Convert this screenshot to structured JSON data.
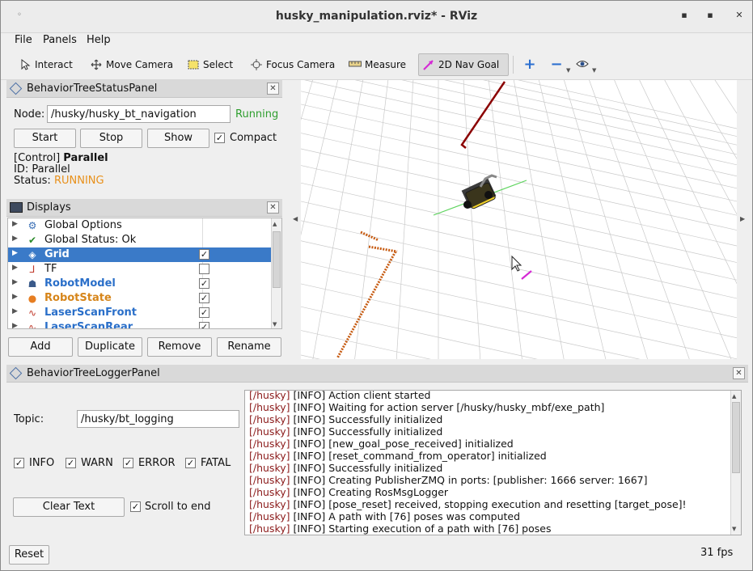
{
  "window": {
    "title": "husky_manipulation.rviz* - RViz",
    "min_glyph": "▪",
    "max_glyph": "▪",
    "close_glyph": "✕"
  },
  "menu": {
    "file": "File",
    "panels": "Panels",
    "help": "Help"
  },
  "toolbar": {
    "interact": "Interact",
    "move_camera": "Move Camera",
    "select": "Select",
    "focus_camera": "Focus Camera",
    "measure": "Measure",
    "nav_goal": "2D Nav Goal",
    "active_tool": "2D Nav Goal",
    "add_glyph": "+",
    "remove_glyph": "−"
  },
  "bt_status_panel": {
    "title": "BehaviorTreeStatusPanel",
    "node_label": "Node:",
    "node_value": "/husky/husky_bt_navigation",
    "state": "Running",
    "start": "Start",
    "stop": "Stop",
    "show": "Show",
    "compact_label": "Compact",
    "compact_checked": true,
    "control_prefix": "[Control]",
    "control_name": "Parallel",
    "id_line": "ID: Parallel",
    "status_label": "Status:",
    "status_value": "RUNNING"
  },
  "displays": {
    "title": "Displays",
    "items": [
      {
        "name": "Global Options",
        "checkable": false,
        "checked": false,
        "selected": false,
        "style": "plain"
      },
      {
        "name": "Global Status: Ok",
        "checkable": false,
        "checked": false,
        "selected": false,
        "style": "plain"
      },
      {
        "name": "Grid",
        "checkable": true,
        "checked": true,
        "selected": true,
        "style": "bold"
      },
      {
        "name": "TF",
        "checkable": true,
        "checked": false,
        "selected": false,
        "style": "plain"
      },
      {
        "name": "RobotModel",
        "checkable": true,
        "checked": true,
        "selected": false,
        "style": "blue"
      },
      {
        "name": "RobotState",
        "checkable": true,
        "checked": true,
        "selected": false,
        "style": "orange"
      },
      {
        "name": "LaserScanFront",
        "checkable": true,
        "checked": true,
        "selected": false,
        "style": "blue"
      },
      {
        "name": "LaserScanRear",
        "checkable": true,
        "checked": true,
        "selected": false,
        "style": "blue"
      }
    ],
    "buttons": {
      "add": "Add",
      "duplicate": "Duplicate",
      "remove": "Remove",
      "rename": "Rename"
    }
  },
  "logger_panel": {
    "title": "BehaviorTreeLoggerPanel",
    "topic_label": "Topic:",
    "topic_value": "/husky/bt_logging",
    "filters": [
      {
        "label": "INFO",
        "checked": true
      },
      {
        "label": "WARN",
        "checked": true
      },
      {
        "label": "ERROR",
        "checked": true
      },
      {
        "label": "FATAL",
        "checked": true
      }
    ],
    "clear_text": "Clear Text",
    "scroll_to_end_label": "Scroll to end",
    "scroll_to_end_checked": true,
    "log_lines": [
      {
        "tag": "[/husky]",
        "text": " [INFO] Action client started"
      },
      {
        "tag": "[/husky]",
        "text": " [INFO] Waiting for action server [/husky/husky_mbf/exe_path]"
      },
      {
        "tag": "[/husky]",
        "text": " [INFO] Successfully initialized"
      },
      {
        "tag": "[/husky]",
        "text": " [INFO] Successfully initialized"
      },
      {
        "tag": "[/husky]",
        "text": " [INFO] [new_goal_pose_received] initialized"
      },
      {
        "tag": "[/husky]",
        "text": " [INFO] [reset_command_from_operator] initialized"
      },
      {
        "tag": "[/husky]",
        "text": " [INFO] Successfully initialized"
      },
      {
        "tag": "[/husky]",
        "text": " [INFO] Creating PublisherZMQ in ports: [publisher: 1666 server: 1667]"
      },
      {
        "tag": "[/husky]",
        "text": " [INFO] Creating RosMsgLogger"
      },
      {
        "tag": "[/husky]",
        "text": " [INFO] [pose_reset] received, stopping execution and resetting [target_pose]!"
      },
      {
        "tag": "[/husky]",
        "text": " [INFO] A path with [76] poses was computed"
      },
      {
        "tag": "[/husky]",
        "text": " [INFO] Starting execution of a path with [76] poses"
      }
    ]
  },
  "statusbar": {
    "reset": "Reset",
    "fps": "31 fps"
  },
  "colors": {
    "running": "#2e9e2e",
    "status_running": "#e8901a",
    "selected_row": "#3a7ac8",
    "display_blue": "#2a6fc9",
    "display_orange": "#d6851a",
    "log_tag": "#8b1a1a"
  },
  "icons": {
    "interact": "cursor-icon",
    "move_camera": "move-icon",
    "select": "select-box-icon",
    "focus_camera": "target-icon",
    "measure": "ruler-icon",
    "nav_goal": "arrow-icon",
    "add": "plus-icon",
    "remove": "minus-icon",
    "view": "eye-icon"
  }
}
